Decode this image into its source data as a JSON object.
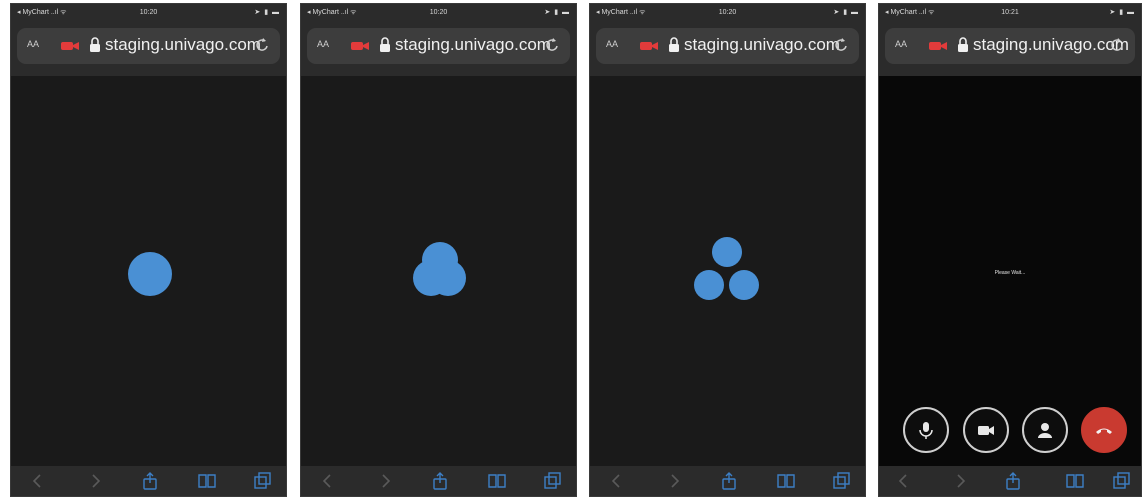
{
  "status_bar": {
    "carrier": "◂ MyChart ..ıl ᯤ",
    "times": [
      "10:20",
      "10:20",
      "10:20",
      "10:21"
    ],
    "indicators": "➤ ▮ ▬"
  },
  "browser": {
    "text_size_label": "AA",
    "domain": "staging.univago.com"
  },
  "call": {
    "status_text": "Please Wait...",
    "controls": [
      "microphone",
      "camera",
      "participant",
      "end-call"
    ],
    "hangup_color": "#c93a30"
  },
  "colors": {
    "accent_blue": "#4a90d4",
    "background": "#1a1a1a"
  },
  "icons": [
    "back-arrow-icon",
    "forward-arrow-icon",
    "share-icon",
    "bookmarks-icon",
    "tabs-icon",
    "lock-icon",
    "reload-icon",
    "camera-recording-icon"
  ]
}
